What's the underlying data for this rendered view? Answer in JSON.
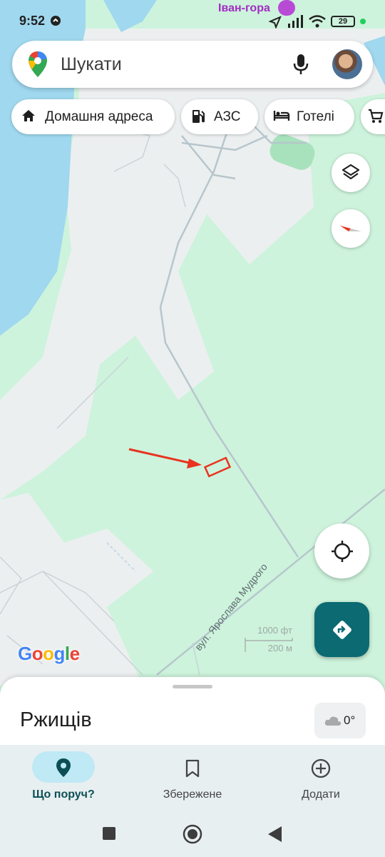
{
  "status_bar": {
    "time": "9:52",
    "place": "Іван-гора",
    "battery": "29"
  },
  "search": {
    "placeholder": "Шукати"
  },
  "chips": [
    {
      "label": "Домашня адреса",
      "icon": "home-icon"
    },
    {
      "label": "АЗС",
      "icon": "gas-station-icon"
    },
    {
      "label": "Готелі",
      "icon": "hotel-bed-icon"
    },
    {
      "label": "",
      "icon": "shopping-cart-icon"
    }
  ],
  "map": {
    "street_label": "вул. Ярослава Мудрого",
    "scale_imperial": "1000 фт",
    "scale_metric": "200 м",
    "attribution": "Google"
  },
  "sheet": {
    "title": "Ржищів",
    "weather": "0°"
  },
  "nav": [
    {
      "label": "Що поруч?",
      "icon": "location-pin-icon",
      "active": true
    },
    {
      "label": "Збережене",
      "icon": "bookmark-icon",
      "active": false
    },
    {
      "label": "Додати",
      "icon": "add-circle-icon",
      "active": false
    }
  ],
  "colors": {
    "accent": "#0b6a72",
    "water": "#9fd8ef",
    "park": "#cdf3dc",
    "marker": "#e8331f"
  }
}
